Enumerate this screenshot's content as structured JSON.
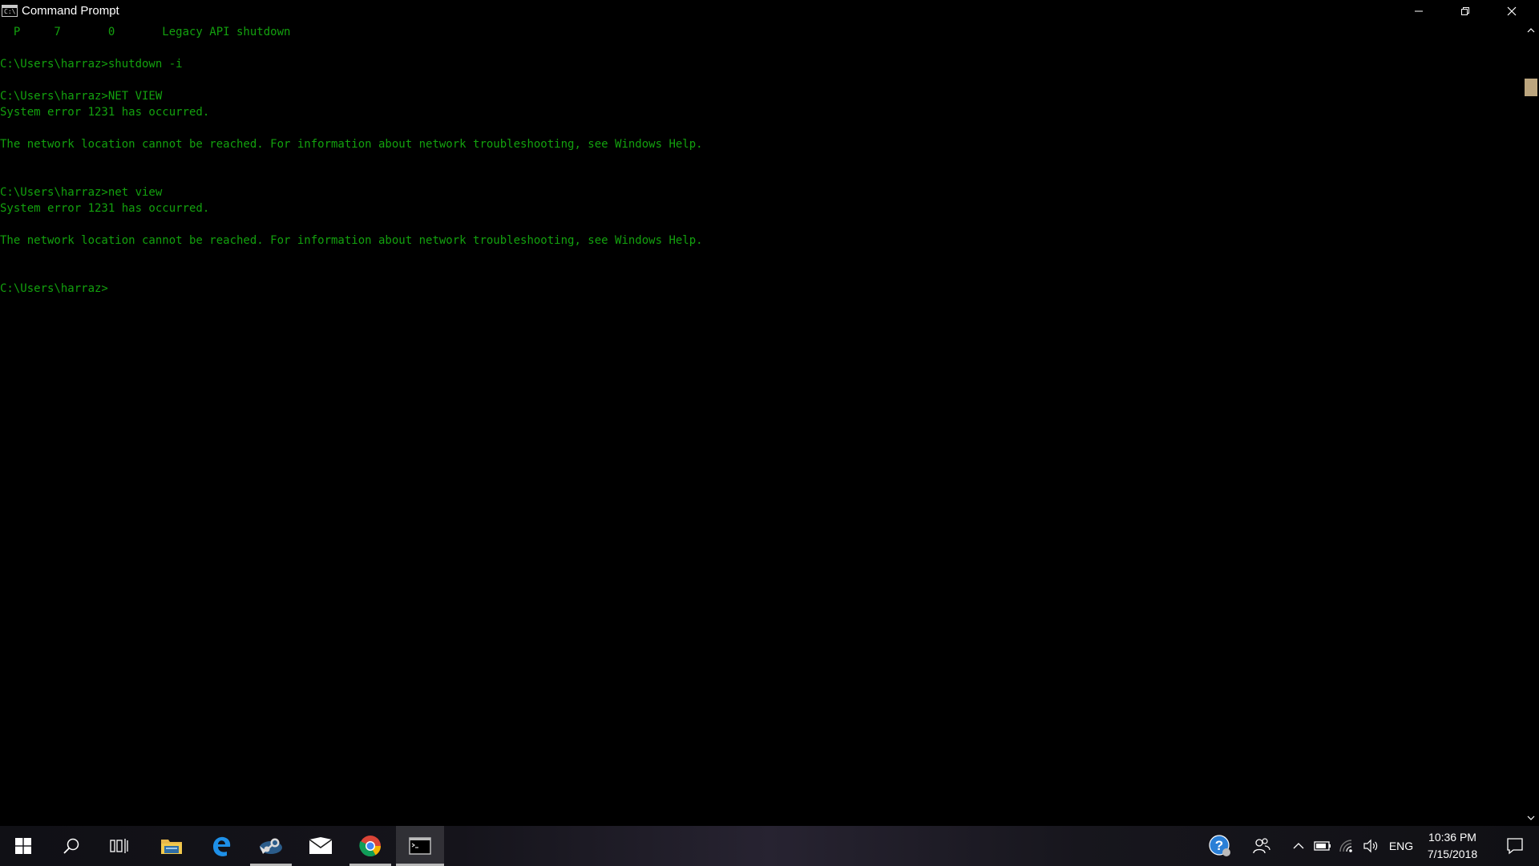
{
  "window": {
    "title": "Command Prompt",
    "app_icon_text": "C:\\",
    "icon": "cmd-icon",
    "controls": {
      "minimize_icon": "minimize-icon",
      "maximize_icon": "restore-icon",
      "close_icon": "close-icon"
    }
  },
  "console": {
    "text_color": "#13a10e",
    "background_color": "#000000",
    "lines": [
      "  P     7       0       Legacy API shutdown",
      "",
      "C:\\Users\\harraz>shutdown -i",
      "",
      "C:\\Users\\harraz>NET VIEW",
      "System error 1231 has occurred.",
      "",
      "The network location cannot be reached. For information about network troubleshooting, see Windows Help.",
      "",
      "",
      "C:\\Users\\harraz>net view",
      "System error 1231 has occurred.",
      "",
      "The network location cannot be reached. For information about network troubleshooting, see Windows Help.",
      "",
      "",
      "C:\\Users\\harraz>"
    ]
  },
  "taskbar": {
    "pinned": [
      {
        "name": "start-button",
        "icon": "windows-logo-icon"
      },
      {
        "name": "search-button",
        "icon": "search-icon"
      },
      {
        "name": "task-view-button",
        "icon": "task-view-icon"
      },
      {
        "name": "file-explorer",
        "icon": "folder-icon"
      },
      {
        "name": "edge",
        "icon": "edge-icon"
      },
      {
        "name": "steam",
        "icon": "steam-icon"
      },
      {
        "name": "mail",
        "icon": "mail-icon"
      },
      {
        "name": "chrome",
        "icon": "chrome-icon"
      },
      {
        "name": "command-prompt",
        "icon": "cmd-icon"
      }
    ],
    "tray": {
      "language": "ENG",
      "time": "10:36 PM",
      "date": "7/15/2018",
      "icons": [
        "help-icon",
        "people-icon",
        "chevron-up-icon",
        "battery-icon",
        "network-icon",
        "volume-icon",
        "notification-icon"
      ]
    }
  }
}
